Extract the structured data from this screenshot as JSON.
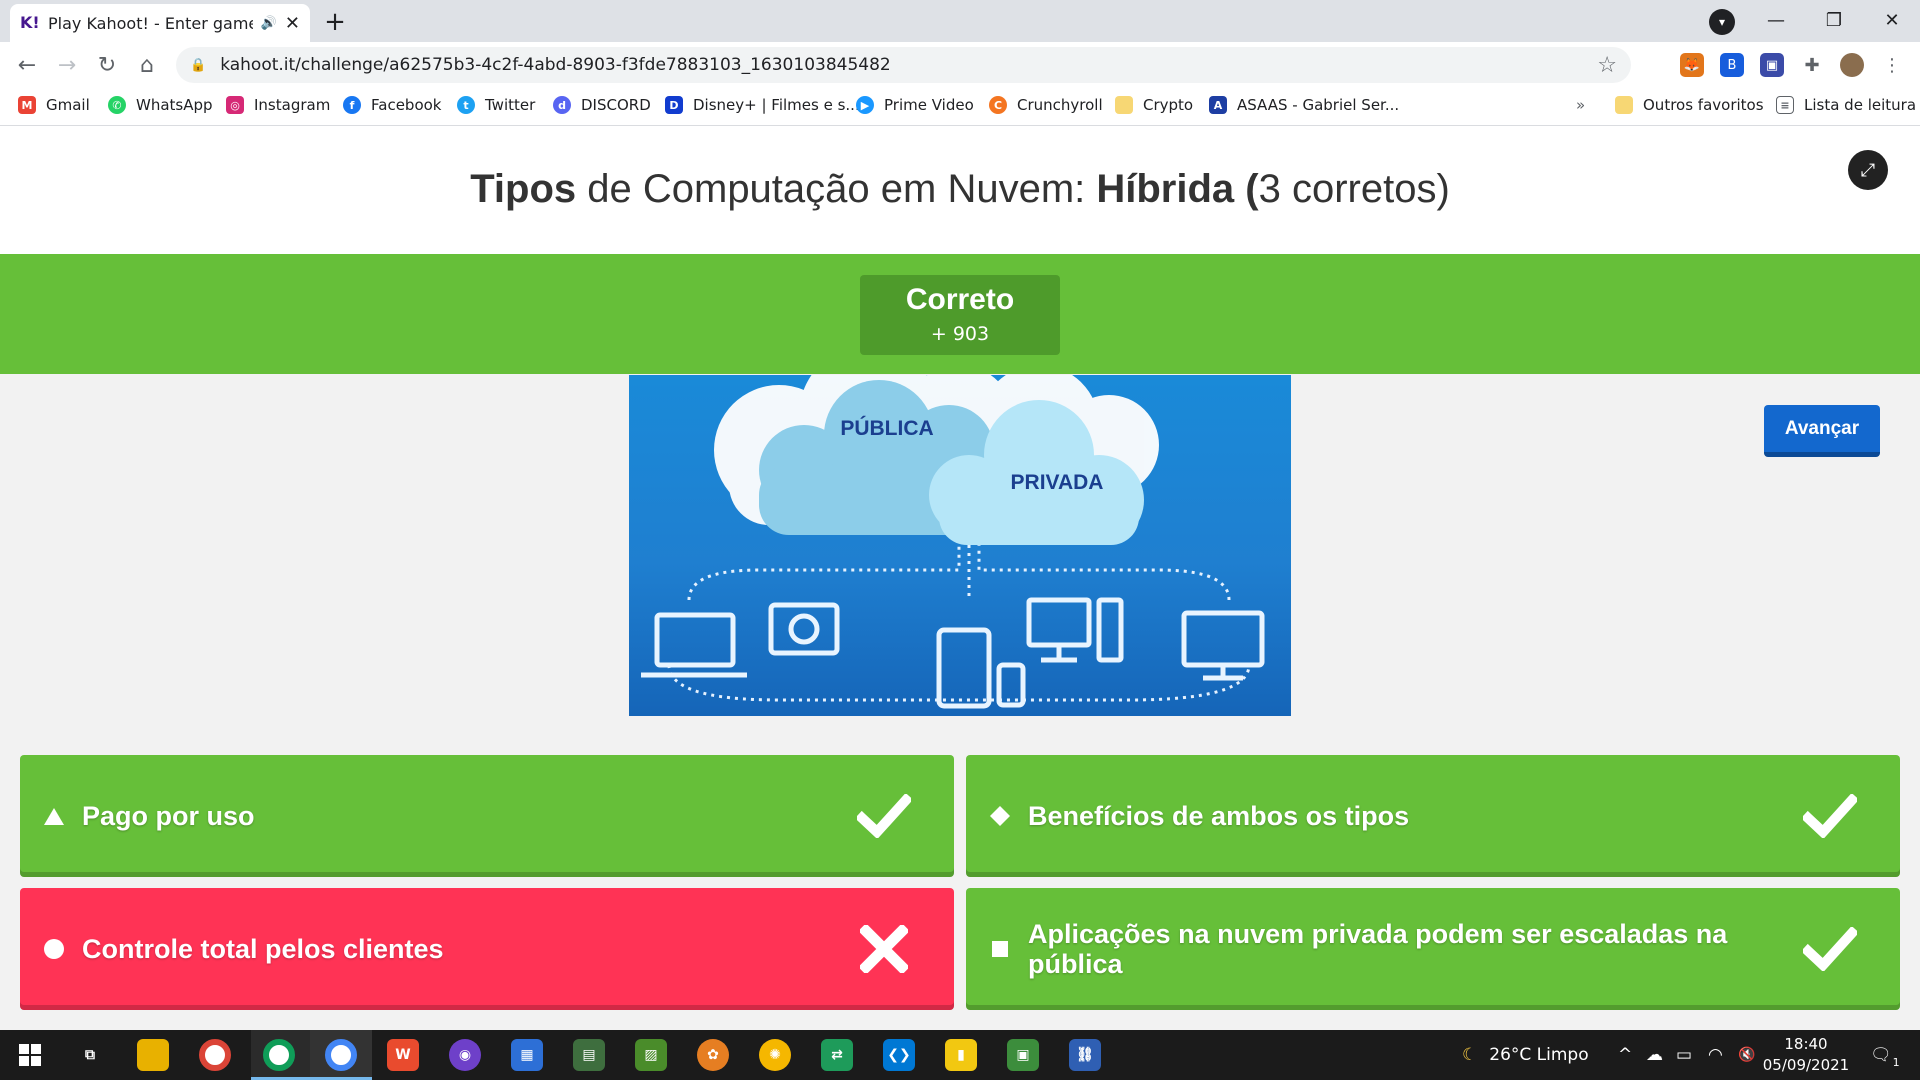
{
  "browser": {
    "tab_title": "Play Kahoot! - Enter game PI",
    "tab_favicon": "K!",
    "url": "kahoot.it/challenge/a62575b3-4c2f-4abd-8903-f3fde7883103_1630103845482",
    "bookmarks": [
      {
        "label": "Gmail",
        "icon": "gmail-icon",
        "color": "#ea4335"
      },
      {
        "label": "WhatsApp",
        "icon": "whatsapp-icon",
        "color": "#25d366"
      },
      {
        "label": "Instagram",
        "icon": "instagram-icon",
        "color": "#d62976"
      },
      {
        "label": "Facebook",
        "icon": "facebook-icon",
        "color": "#1877f2"
      },
      {
        "label": "Twitter",
        "icon": "twitter-icon",
        "color": "#1da1f2"
      },
      {
        "label": "DISCORD",
        "icon": "discord-icon",
        "color": "#5865f2"
      },
      {
        "label": "Disney+ | Filmes e s...",
        "icon": "disney-icon",
        "color": "#113ccf"
      },
      {
        "label": "Prime Video",
        "icon": "prime-video-icon",
        "color": "#1a98ff"
      },
      {
        "label": "Crunchyroll",
        "icon": "crunchyroll-icon",
        "color": "#f47521"
      },
      {
        "label": "Crypto",
        "icon": "folder-icon",
        "color": "#f7d774"
      },
      {
        "label": "ASAAS - Gabriel Ser...",
        "icon": "asaas-icon",
        "color": "#1d3ea3"
      }
    ],
    "overflow": "»",
    "other_bookmarks": "Outros favoritos",
    "reading_list": "Lista de leitura"
  },
  "quiz": {
    "title_part1": "Tipos",
    "title_part2": " de Computação em Nuvem: ",
    "title_part3": "Híbrida (",
    "title_part4": "3 corretos)",
    "result_label": "Correto",
    "result_points": "+ 903",
    "next_button": "Avançar",
    "image_labels": {
      "public": "PÚBLICA",
      "private": "PRIVADA"
    },
    "answers": [
      {
        "shape": "triangle-icon",
        "text": "Pago por uso",
        "correct": true,
        "color": "#66bf39"
      },
      {
        "shape": "diamond-icon",
        "text": "Benefícios de ambos os tipos",
        "correct": true,
        "color": "#66bf39"
      },
      {
        "shape": "circle-icon",
        "text": "Controle total pelos clientes",
        "correct": false,
        "color": "#ff3355"
      },
      {
        "shape": "square-icon",
        "text": "Aplicações na nuvem privada podem ser escaladas na pública",
        "correct": true,
        "color": "#66bf39"
      }
    ]
  },
  "taskbar": {
    "weather": "26°C  Limpo",
    "time": "18:40",
    "date": "05/09/2021",
    "notification_count": "1"
  }
}
